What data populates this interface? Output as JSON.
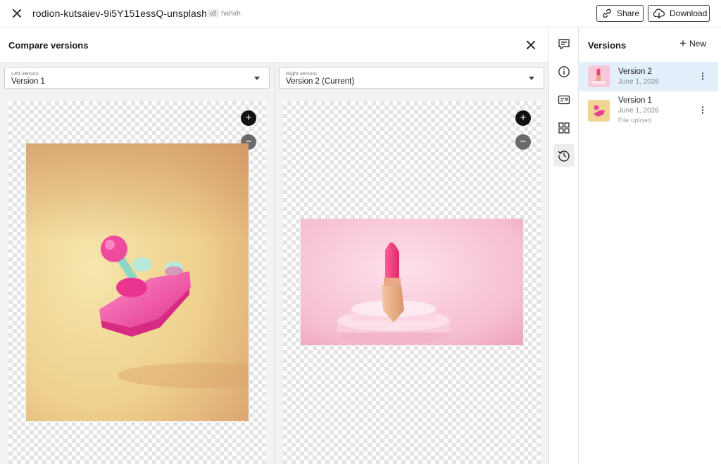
{
  "header": {
    "file_name": "rodion-kutsaiev-9i5Y151essQ-unsplash",
    "version_badge": "v2",
    "version_note": "hahah",
    "share_label": "Share",
    "download_label": "Download",
    "close_icon": "close-icon"
  },
  "compare": {
    "title": "Compare versions",
    "left": {
      "caption": "Left version",
      "value": "Version 1",
      "image": "pink-joystick-on-yellow"
    },
    "right": {
      "caption": "Right version",
      "value": "Version 2 (Current)",
      "image": "pink-lipstick-on-pedestal"
    },
    "zoom_in": "+",
    "zoom_out": "−"
  },
  "rail": {
    "icons": [
      "comment-icon",
      "info-icon",
      "id-card-icon",
      "grid-icon",
      "history-icon"
    ],
    "active": "history-icon"
  },
  "versions": {
    "title": "Versions",
    "new_label": "New",
    "items": [
      {
        "name": "Version 2",
        "date": "June 1, 2026",
        "sub": "",
        "selected": true
      },
      {
        "name": "Version 1",
        "date": "June 1, 2026",
        "sub": "File upload",
        "selected": false
      }
    ]
  },
  "colors": {
    "accent_selection": "#e3effb",
    "border_dark": "#3a3a3a",
    "zoom_dark": "#111111"
  }
}
